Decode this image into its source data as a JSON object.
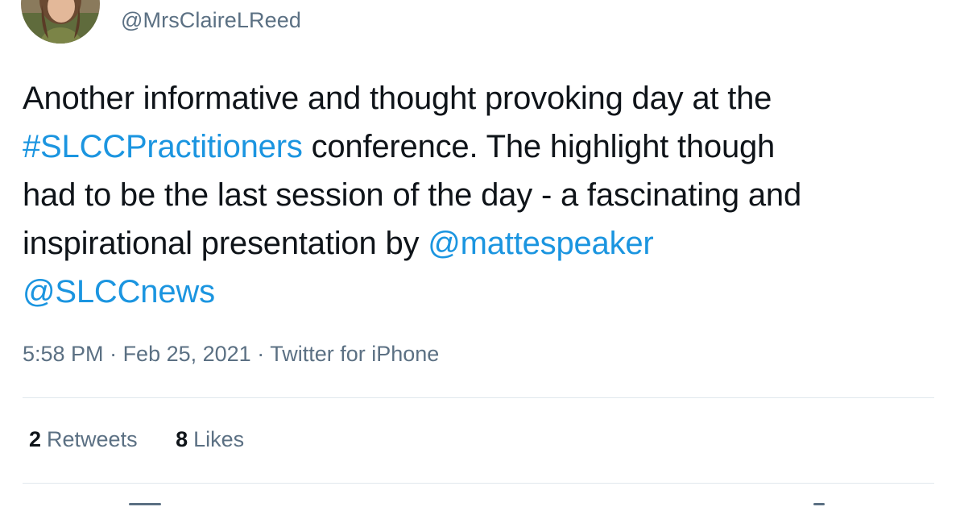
{
  "author": {
    "handle": "@MrsClaireLReed",
    "avatar_icon": "profile-photo"
  },
  "tweet": {
    "lines": [
      [
        {
          "text": "Another informative and thought provoking day at the",
          "type": "text"
        }
      ],
      [
        {
          "text": "#SLCCPractitioners",
          "type": "hashtag"
        },
        {
          "text": " conference. The highlight though",
          "type": "text"
        }
      ],
      [
        {
          "text": "had to be the last session of the day - a fascinating and",
          "type": "text"
        }
      ],
      [
        {
          "text": "inspirational presentation by ",
          "type": "text"
        },
        {
          "text": "@mattespeaker",
          "type": "mention"
        }
      ],
      [
        {
          "text": "@SLCCnews",
          "type": "mention"
        }
      ]
    ]
  },
  "meta": {
    "time": "5:58 PM",
    "separator": " · ",
    "date": "Feb 25, 2021",
    "source": "Twitter for iPhone"
  },
  "stats": {
    "retweets_count": "2",
    "retweets_label": "Retweets",
    "likes_count": "8",
    "likes_label": "Likes"
  },
  "colors": {
    "link": "#1b95e0",
    "secondary_text": "#5b7083",
    "primary_text": "#0f1419",
    "divider": "#e1e8ed"
  }
}
